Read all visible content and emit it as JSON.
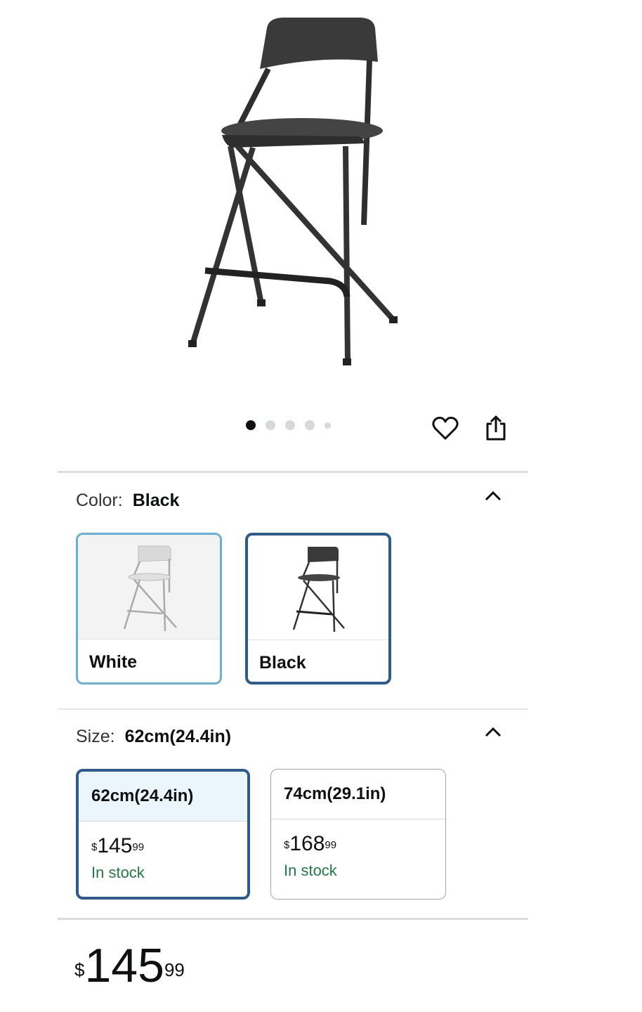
{
  "gallery": {
    "image_icon": "black-folding-bar-stool-image",
    "dot_count": 5,
    "active_dot": 0
  },
  "actions": {
    "favorite_icon": "heart-icon",
    "share_icon": "share-icon"
  },
  "color": {
    "label": "Color:",
    "selected": "Black",
    "options": [
      {
        "label": "White",
        "icon": "white-stool-thumbnail"
      },
      {
        "label": "Black",
        "icon": "black-stool-thumbnail"
      }
    ]
  },
  "size": {
    "label": "Size:",
    "selected": "62cm(24.4in)",
    "options": [
      {
        "label": "62cm(24.4in)",
        "price_currency": "$",
        "price_whole": "145",
        "price_cents": "99",
        "stock": "In stock"
      },
      {
        "label": "74cm(29.1in)",
        "price_currency": "$",
        "price_whole": "168",
        "price_cents": "99",
        "stock": "In stock"
      }
    ]
  },
  "price": {
    "currency": "$",
    "whole": "145",
    "cents": "99"
  },
  "colors": {
    "accent_selected": "#2d5b8d",
    "accent_light": "#6ab0d6",
    "in_stock": "#207a45"
  }
}
